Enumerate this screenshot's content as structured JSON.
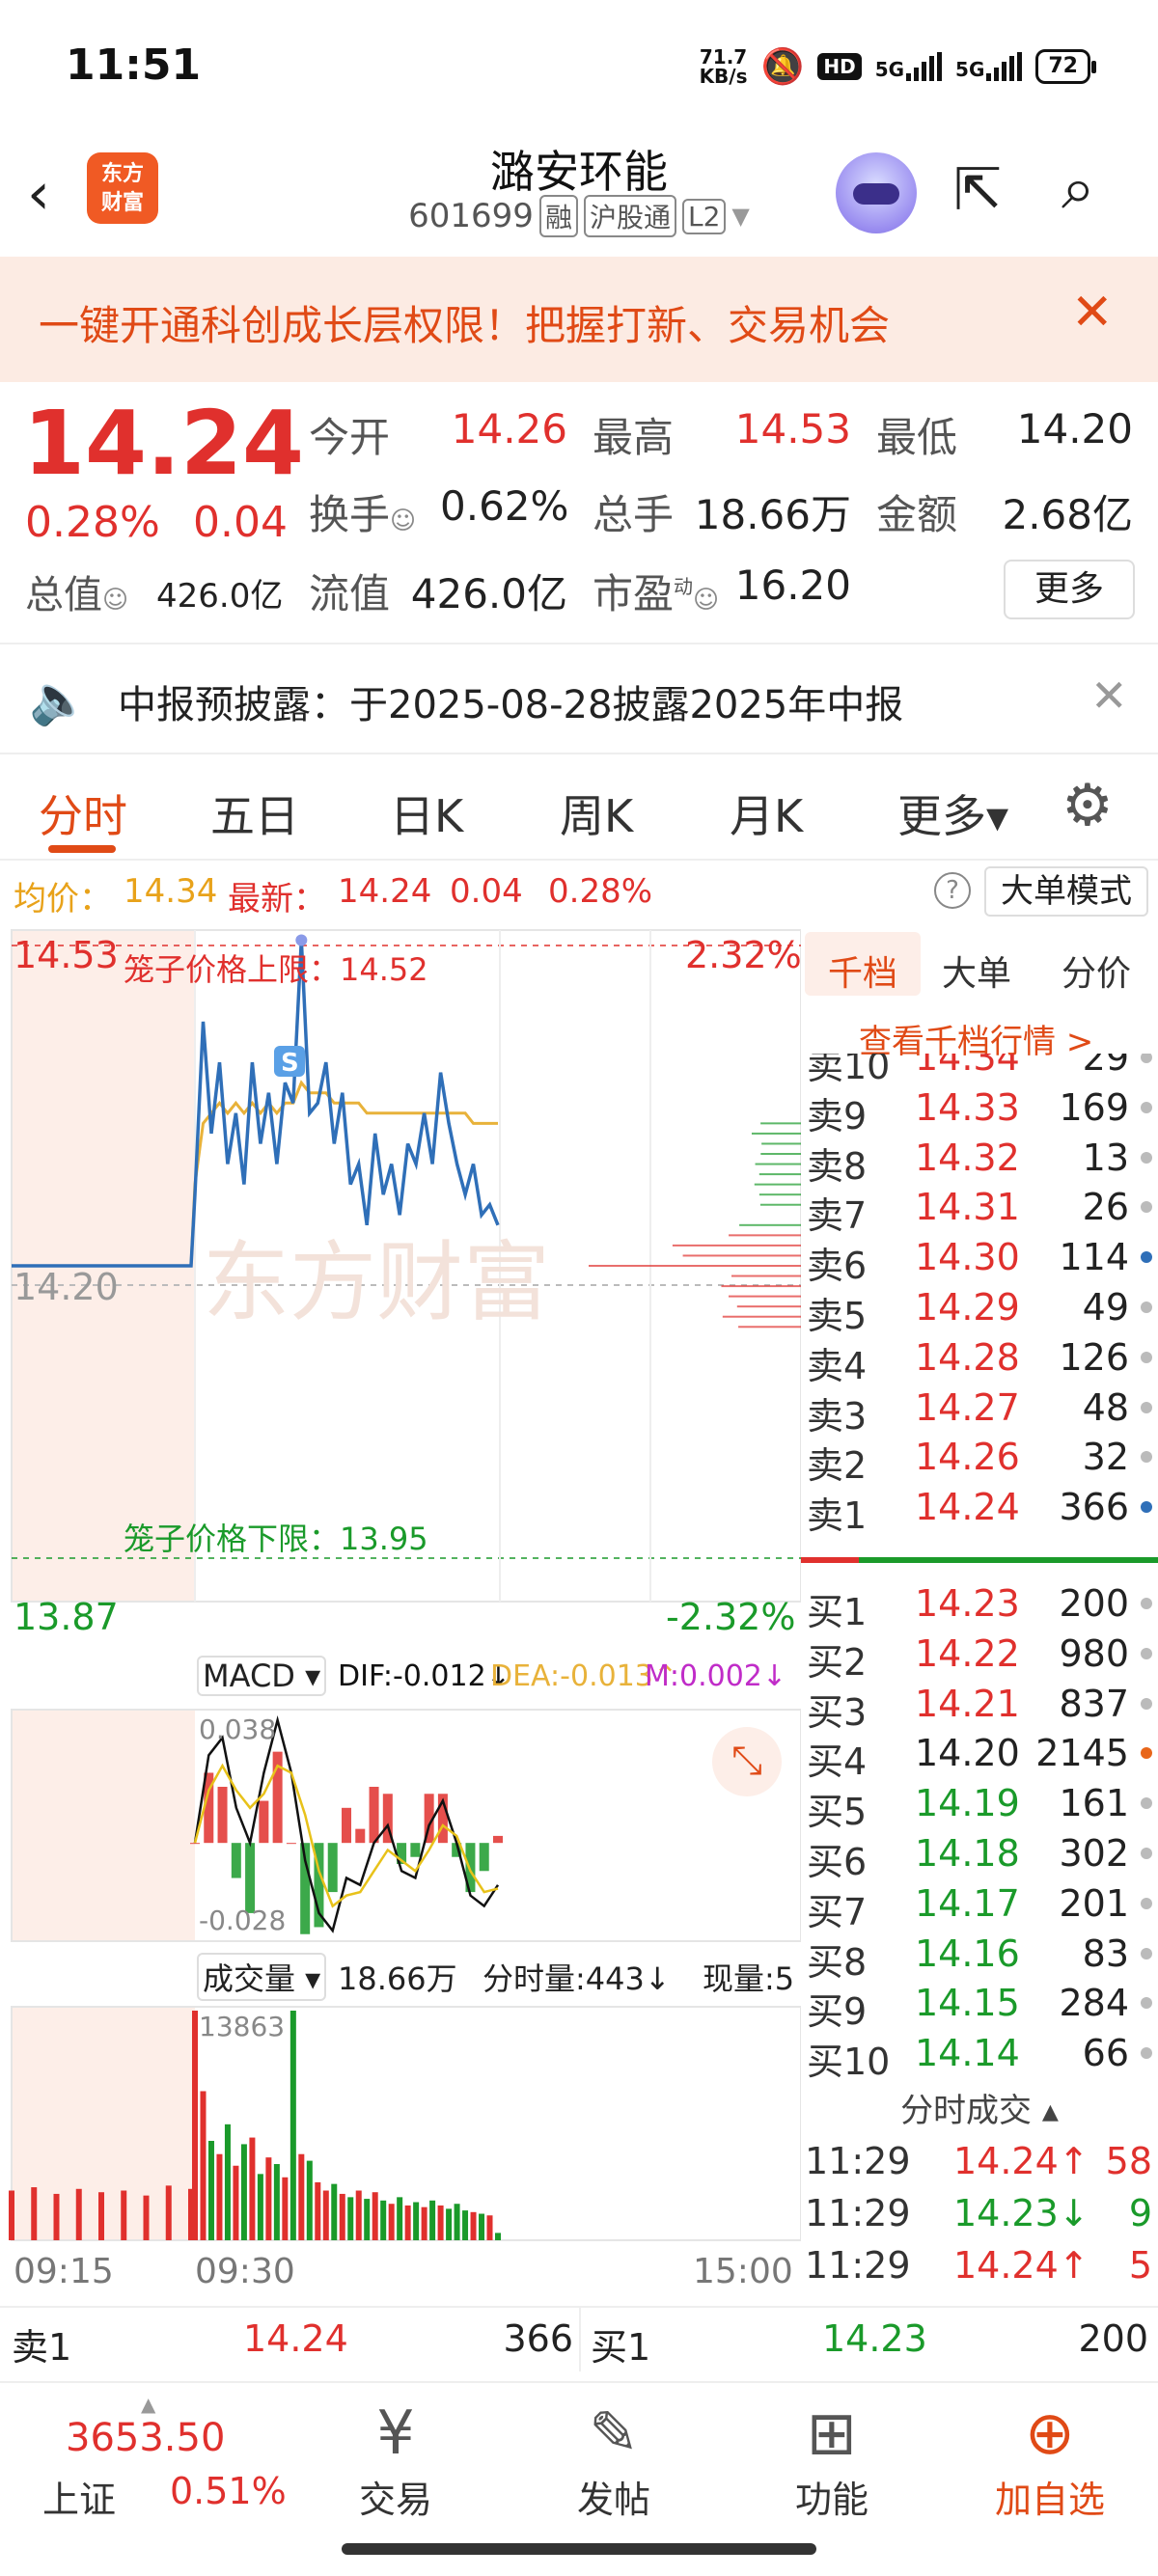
{
  "status": {
    "time": "11:51",
    "net_speed_value": "71.7",
    "net_speed_unit": "KB/s",
    "hd_badge": "HD",
    "sig1": "5G",
    "sig2": "5G",
    "battery": "72"
  },
  "header": {
    "logo_line1": "东方",
    "logo_line2": "财富",
    "stock_name": "潞安环能",
    "stock_code": "601699",
    "tags": [
      "融",
      "沪股通",
      "L2"
    ]
  },
  "banner": {
    "text": "一键开通科创成长层权限！把握打新、交易机会"
  },
  "quote": {
    "price": "14.24",
    "change_pct": "0.28%",
    "change_amt": "0.04",
    "mktcap_label": "总值",
    "mktcap_value": "426.0亿",
    "open_label": "今开",
    "open_value": "14.26",
    "high_label": "最高",
    "high_value": "14.53",
    "low_label": "最低",
    "low_value": "14.20",
    "turnover_label": "换手",
    "turnover_value": "0.62%",
    "volume_label": "总手",
    "volume_value": "18.66万",
    "amount_label": "金额",
    "amount_value": "2.68亿",
    "float_label": "流值",
    "float_value": "426.0亿",
    "pe_label": "市盈",
    "pe_sup": "动",
    "pe_value": "16.20",
    "more_label": "更多"
  },
  "notice": {
    "text": "中报预披露：于2025-08-28披露2025年中报"
  },
  "tabs": [
    {
      "label": "分时"
    },
    {
      "label": "五日"
    },
    {
      "label": "日K"
    },
    {
      "label": "周K"
    },
    {
      "label": "月K"
    },
    {
      "label": "更多▾"
    }
  ],
  "inforow": {
    "avg_label": "均价：",
    "avg_value": "14.34",
    "latest_label": "最新：",
    "latest_value": "14.24",
    "chg": "0.04",
    "pct": "0.28%",
    "help": "?",
    "big_order_mode": "大单模式"
  },
  "chart": {
    "y_top": "14.53",
    "y_mid": "14.20",
    "y_bottom": "13.87",
    "pct_top": "2.32%",
    "pct_bottom": "-2.32%",
    "cage_upper": "笼子价格上限：14.52",
    "cage_lower": "笼子价格下限：13.95",
    "s_marker": "S",
    "watermark": "东方财富",
    "macd_label": "MACD ▾",
    "macd_dif": "DIF:-0.012↓",
    "macd_dea": "DEA:-0.013↑",
    "macd_m": "M:0.002↓",
    "macd_top": "0.038",
    "macd_bottom": "-0.028",
    "vol_label": "成交量 ▾",
    "vol_total": "18.66万",
    "vol_minute": "分时量:443↓",
    "vol_now": "现量:5",
    "vol_max": "13863",
    "time_start": "09:15",
    "time_open": "09:30",
    "time_end": "15:00"
  },
  "chart_data": {
    "type": "line",
    "title": "",
    "ylim": [
      13.87,
      14.53
    ],
    "prev_close": 14.2,
    "cage_upper": 14.52,
    "cage_lower": 13.95,
    "price_series": [
      14.2,
      14.2,
      14.2,
      14.2,
      14.2,
      14.2,
      14.2,
      14.2,
      14.2,
      14.27,
      14.44,
      14.33,
      14.4,
      14.3,
      14.35,
      14.28,
      14.4,
      14.32,
      14.37,
      14.3,
      14.38,
      14.36,
      14.52,
      14.35,
      14.36,
      14.4,
      14.32,
      14.37,
      14.28,
      14.3,
      14.24,
      14.33,
      14.27,
      14.3,
      14.25,
      14.32,
      14.3,
      14.35,
      14.3,
      14.39,
      14.34,
      14.3,
      14.27,
      14.3,
      14.25,
      14.26,
      14.24
    ],
    "avg_series": [
      14.2,
      14.2,
      14.2,
      14.2,
      14.2,
      14.2,
      14.2,
      14.2,
      14.2,
      14.28,
      14.34,
      14.35,
      14.36,
      14.35,
      14.36,
      14.35,
      14.36,
      14.35,
      14.36,
      14.35,
      14.36,
      14.36,
      14.38,
      14.37,
      14.37,
      14.37,
      14.36,
      14.36,
      14.36,
      14.36,
      14.35,
      14.35,
      14.35,
      14.35,
      14.35,
      14.35,
      14.35,
      14.35,
      14.35,
      14.35,
      14.35,
      14.35,
      14.35,
      14.34,
      14.34,
      14.34,
      14.34
    ],
    "macd_dif": [
      0.0,
      0.025,
      0.03,
      0.01,
      0.0,
      0.02,
      0.035,
      0.02,
      -0.005,
      -0.02,
      -0.025,
      -0.01,
      -0.012,
      0.0,
      0.005,
      -0.008,
      -0.01,
      0.005,
      0.012,
      0.0,
      -0.015,
      -0.018,
      -0.012
    ],
    "macd_dea": [
      0.0,
      0.015,
      0.022,
      0.015,
      0.01,
      0.014,
      0.022,
      0.02,
      0.008,
      -0.008,
      -0.018,
      -0.015,
      -0.014,
      -0.008,
      -0.002,
      -0.005,
      -0.008,
      -0.002,
      0.005,
      0.002,
      -0.008,
      -0.014,
      -0.013
    ],
    "macd_bar": [
      0.0,
      0.02,
      0.016,
      -0.01,
      -0.02,
      0.012,
      0.026,
      0.0,
      -0.026,
      -0.024,
      -0.014,
      0.01,
      0.004,
      0.016,
      0.014,
      -0.006,
      -0.004,
      0.014,
      0.014,
      -0.004,
      -0.014,
      -0.008,
      0.002
    ],
    "volume": [
      3000,
      3200,
      2800,
      3100,
      2900,
      3000,
      2700,
      3300,
      3100,
      13863,
      9000,
      6000,
      5200,
      7000,
      4500,
      5800,
      6200,
      4000,
      5000,
      4600,
      3800,
      13863,
      5200,
      4800,
      3500,
      3000,
      3400,
      2800,
      2600,
      3000,
      2500,
      2900,
      2400,
      2200,
      2600,
      2100,
      2300,
      2000,
      2400,
      2100,
      1900,
      2200,
      1800,
      1700,
      1600,
      1500,
      443
    ]
  },
  "orderbook": {
    "tabs": [
      "千档",
      "大单",
      "分价"
    ],
    "view_thousand": "查看千档行情 >",
    "asks": [
      {
        "label": "卖10",
        "price": "14.34",
        "qty": "29"
      },
      {
        "label": "卖9",
        "price": "14.33",
        "qty": "169"
      },
      {
        "label": "卖8",
        "price": "14.32",
        "qty": "13"
      },
      {
        "label": "卖7",
        "price": "14.31",
        "qty": "26"
      },
      {
        "label": "卖6",
        "price": "14.30",
        "qty": "114"
      },
      {
        "label": "卖5",
        "price": "14.29",
        "qty": "49"
      },
      {
        "label": "卖4",
        "price": "14.28",
        "qty": "126"
      },
      {
        "label": "卖3",
        "price": "14.27",
        "qty": "48"
      },
      {
        "label": "卖2",
        "price": "14.26",
        "qty": "32"
      },
      {
        "label": "卖1",
        "price": "14.24",
        "qty": "366"
      }
    ],
    "bids": [
      {
        "label": "买1",
        "price": "14.23",
        "qty": "200"
      },
      {
        "label": "买2",
        "price": "14.22",
        "qty": "980"
      },
      {
        "label": "买3",
        "price": "14.21",
        "qty": "837"
      },
      {
        "label": "买4",
        "price": "14.20",
        "qty": "2145"
      },
      {
        "label": "买5",
        "price": "14.19",
        "qty": "161"
      },
      {
        "label": "买6",
        "price": "14.18",
        "qty": "302"
      },
      {
        "label": "买7",
        "price": "14.17",
        "qty": "201"
      },
      {
        "label": "买8",
        "price": "14.16",
        "qty": "83"
      },
      {
        "label": "买9",
        "price": "14.15",
        "qty": "284"
      },
      {
        "label": "买10",
        "price": "14.14",
        "qty": "66"
      }
    ],
    "trades_label": "分时成交 ▴",
    "trades": [
      {
        "time": "11:29",
        "price": "14.24↑",
        "qty": "58"
      },
      {
        "time": "11:29",
        "price": "14.23↓",
        "qty": "9"
      },
      {
        "time": "11:29",
        "price": "14.24↑",
        "qty": "5"
      }
    ]
  },
  "ticker": {
    "sell_label": "卖1",
    "sell_price": "14.24",
    "sell_qty": "366",
    "buy_label": "买1",
    "buy_price": "14.23",
    "buy_qty": "200"
  },
  "bottomnav": {
    "index_value": "3653.50",
    "index_name": "上证",
    "index_pct": "0.51%",
    "items": [
      {
        "label": "交易",
        "icon": "trade-icon"
      },
      {
        "label": "发帖",
        "icon": "post-icon"
      },
      {
        "label": "功能",
        "icon": "apps-icon"
      },
      {
        "label": "加自选",
        "icon": "add-watchlist-icon"
      }
    ]
  },
  "colors": {
    "up": "#e0302d",
    "down": "#1a9a2a",
    "accent": "#e04a16",
    "price_line": "#2f6fb8",
    "avg_line": "#e8b23a"
  }
}
